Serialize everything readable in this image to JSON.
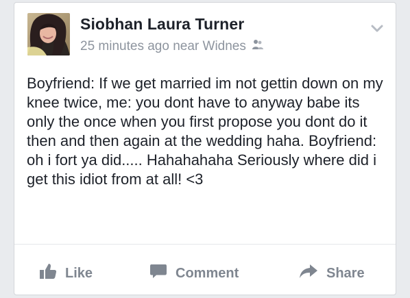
{
  "post": {
    "author_name": "Siobhan Laura Turner",
    "meta_text": "25 minutes ago near Widnes",
    "audience_icon": "friends-icon",
    "menu_icon": "chevron-down-icon",
    "body_text": "Boyfriend: If we get married im not gettin down on my knee twice, me: you dont have to anyway babe its only the once when you first propose you dont do it then and then again at the wedding haha. Boyfriend: oh i fort ya did..... Hahahahaha Seriously where did i get this idiot from at all! <3"
  },
  "actions": {
    "like_label": "Like",
    "comment_label": "Comment",
    "share_label": "Share"
  },
  "colors": {
    "text_primary": "#1d2129",
    "text_secondary": "#8d949e",
    "card_border": "#d4d6da"
  }
}
